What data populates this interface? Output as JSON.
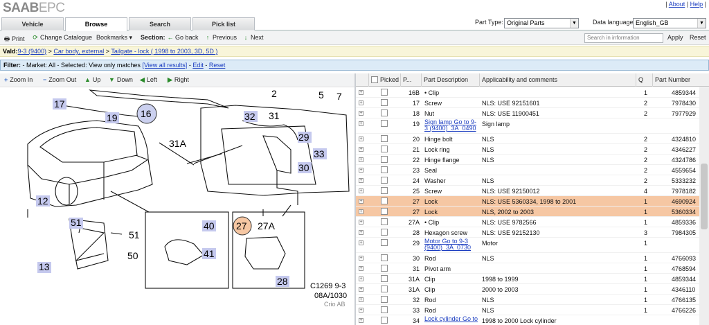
{
  "app": {
    "brand_saab": "SAAB",
    "brand_epc": "EPC"
  },
  "top_links": {
    "about": "About",
    "help": "Help"
  },
  "tabs": [
    "Vehicle",
    "Browse",
    "Search",
    "Pick list"
  ],
  "part_type": {
    "label": "Part Type:",
    "value": "Original Parts"
  },
  "data_language": {
    "label": "Data language:",
    "value": "English_GB"
  },
  "toolbar": {
    "print": "Print",
    "change_catalogue": "Change Catalogue",
    "bookmarks": "Bookmarks",
    "section": "Section:",
    "go_back": "Go back",
    "previous": "Previous",
    "next": "Next",
    "search_placeholder": "Search in information",
    "apply": "Apply",
    "reset": "Reset"
  },
  "valid": {
    "label": "Vald:",
    "model": "9-3 (9400)",
    "sep": ">",
    "group": "Car body, external",
    "section": "Tailgate - lock ( 1998 to 2003, 3D, 5D )"
  },
  "filter": {
    "label": "Filter:",
    "text": "- Market: All - Selected: View only matches",
    "view_all": "[View all results]",
    "edit": "Edit",
    "reset": "Reset"
  },
  "image_nav": {
    "zoom_in": "Zoom In",
    "zoom_out": "Zoom Out",
    "up": "Up",
    "down": "Down",
    "left": "Left",
    "right": "Right"
  },
  "diagram": {
    "callouts": [
      "2",
      "5",
      "7",
      "17",
      "19",
      "16",
      "32",
      "31",
      "29",
      "33",
      "30",
      "31A",
      "12",
      "51",
      "51",
      "50",
      "13",
      "40",
      "41",
      "27",
      "27A",
      "28"
    ],
    "caption_1": "C1269 9-3",
    "caption_2": "08A/1030",
    "watermark": "Crio AB"
  },
  "table": {
    "headers": [
      "Picked",
      "P...",
      "Part Description",
      "Applicability and comments",
      "Q",
      "Part Number"
    ],
    "rows": [
      {
        "pos": "16B",
        "desc": "• Clip",
        "comment": "",
        "q": "1",
        "pn": "4859344",
        "link": false,
        "hl": false
      },
      {
        "pos": "17",
        "desc": "Screw",
        "comment": "NLS: USE 92151601",
        "q": "2",
        "pn": "7978430",
        "link": false,
        "hl": false
      },
      {
        "pos": "18",
        "desc": "Nut",
        "comment": "NLS: USE 11900451",
        "q": "2",
        "pn": "7977929",
        "link": false,
        "hl": false
      },
      {
        "pos": "19",
        "desc": "Sign lamp Go to 9-3 (9400)_3A_0490",
        "comment": "Sign lamp",
        "q": "",
        "pn": "",
        "link": true,
        "hl": false
      },
      {
        "pos": "20",
        "desc": "Hinge bolt",
        "comment": "NLS",
        "q": "2",
        "pn": "4324810",
        "link": false,
        "hl": false
      },
      {
        "pos": "21",
        "desc": "Lock ring",
        "comment": "NLS",
        "q": "2",
        "pn": "4346227",
        "link": false,
        "hl": false
      },
      {
        "pos": "22",
        "desc": "Hinge flange",
        "comment": "NLS",
        "q": "2",
        "pn": "4324786",
        "link": false,
        "hl": false
      },
      {
        "pos": "23",
        "desc": "Seal",
        "comment": "",
        "q": "2",
        "pn": "4559654",
        "link": false,
        "hl": false
      },
      {
        "pos": "24",
        "desc": "Washer",
        "comment": "NLS",
        "q": "2",
        "pn": "5333232",
        "link": false,
        "hl": false
      },
      {
        "pos": "25",
        "desc": "Screw",
        "comment": "NLS: USE 92150012",
        "q": "4",
        "pn": "7978182",
        "link": false,
        "hl": false
      },
      {
        "pos": "27",
        "desc": "Lock",
        "comment": "NLS: USE 5360334, 1998 to 2001",
        "q": "1",
        "pn": "4690924",
        "link": false,
        "hl": true
      },
      {
        "pos": "27",
        "desc": "Lock",
        "comment": "NLS, 2002 to 2003",
        "q": "1",
        "pn": "5360334",
        "link": false,
        "hl": true
      },
      {
        "pos": "27A",
        "desc": "• Clip",
        "comment": "NLS: USE 9782566",
        "q": "1",
        "pn": "4859336",
        "link": false,
        "hl": false
      },
      {
        "pos": "28",
        "desc": "Hexagon screw",
        "comment": "NLS: USE 92152130",
        "q": "3",
        "pn": "7984305",
        "link": false,
        "hl": false
      },
      {
        "pos": "29",
        "desc": "Motor Go to 9-3 (9400)_3A_0730",
        "comment": "Motor",
        "q": "1",
        "pn": "",
        "link": true,
        "hl": false
      },
      {
        "pos": "30",
        "desc": "Rod",
        "comment": "NLS",
        "q": "1",
        "pn": "4766093",
        "link": false,
        "hl": false
      },
      {
        "pos": "31",
        "desc": "Pivot arm",
        "comment": "",
        "q": "1",
        "pn": "4768594",
        "link": false,
        "hl": false
      },
      {
        "pos": "31A",
        "desc": "Clip",
        "comment": "1998 to 1999",
        "q": "1",
        "pn": "4859344",
        "link": false,
        "hl": false
      },
      {
        "pos": "31A",
        "desc": "Clip",
        "comment": "2000 to 2003",
        "q": "1",
        "pn": "4346110",
        "link": false,
        "hl": false
      },
      {
        "pos": "32",
        "desc": "Rod",
        "comment": "NLS",
        "q": "1",
        "pn": "4766135",
        "link": false,
        "hl": false
      },
      {
        "pos": "33",
        "desc": "Rod",
        "comment": "NLS",
        "q": "1",
        "pn": "4766226",
        "link": false,
        "hl": false
      },
      {
        "pos": "34",
        "desc": "Lock cylinder Go to",
        "comment": "1998 to 2000 Lock cylinder",
        "q": "",
        "pn": "",
        "link": true,
        "hl": false
      }
    ]
  },
  "colors": {
    "highlight_row": "#f6c7a3",
    "link": "#1a3cc0",
    "filter_bg": "#dcebf7",
    "valid_bg": "#f8f5d9"
  }
}
